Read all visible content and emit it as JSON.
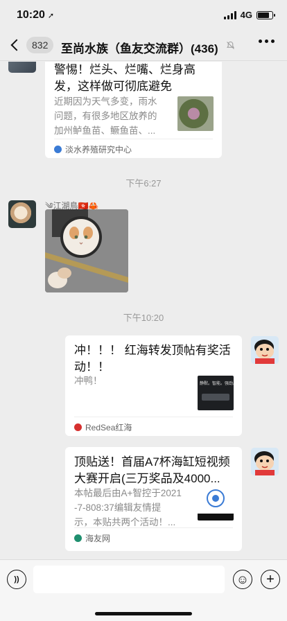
{
  "status_bar": {
    "time": "10:20",
    "location_glyph": "➚",
    "network": "4G",
    "battery_level": 0.8
  },
  "nav": {
    "unread_count": "832",
    "title": "至尚水族（鱼友交流群）(436)",
    "mute_glyph": "🔕"
  },
  "messages": [
    {
      "type": "link-card",
      "title_lines": [
        "警惕！烂头、烂嘴、烂身高",
        "发，这样做可彻底避免"
      ],
      "desc_lines": [
        "近期因为天气多变，雨水",
        "问题，有很多地区放养的",
        "加州鲈鱼苗、鳜鱼苗、..."
      ],
      "source": "淡水养殖研究中心",
      "source_icon_color": "#3a7bd5"
    },
    {
      "type": "time",
      "text": "下午6:27"
    },
    {
      "type": "image",
      "sender": "༄江湖鳥🇭🇰🦀"
    },
    {
      "type": "time",
      "text": "下午10:20"
    },
    {
      "type": "link-card",
      "title_lines": [
        "冲！！！ 红海转发顶帖有奖活",
        "动！！"
      ],
      "desc_lines": [
        "冲鸭！"
      ],
      "thumb_text": "静默。智能。强劲。",
      "source": "RedSea红海",
      "source_icon_color": "#d6302f"
    },
    {
      "type": "link-card",
      "title_lines": [
        "顶贴送！首届A7杯海缸短视频",
        "大赛开启(三万奖品及4000..."
      ],
      "desc_lines": [
        "本帖最后由A+智控于2021",
        "-7-808:37编辑友情提",
        "示，本贴共两个活动！..."
      ],
      "source": "海友网",
      "source_icon_color": "#1f8f6f"
    }
  ],
  "input_bar": {
    "voice_glyph": "))",
    "emoji_glyph": "☺",
    "add_glyph": "+"
  }
}
